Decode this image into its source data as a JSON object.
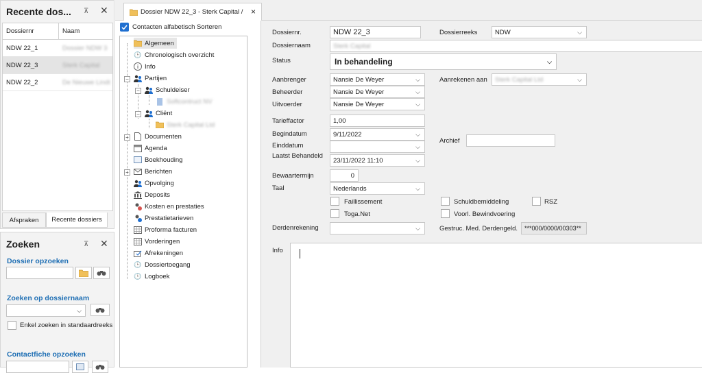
{
  "recent": {
    "title": "Recente dos...",
    "columns": [
      "Dossiernr",
      "Naam"
    ],
    "rows": [
      {
        "nr": "NDW 22_1",
        "naam": "Dossier NDW 3"
      },
      {
        "nr": "NDW 22_3",
        "naam": "Sterk Capital"
      },
      {
        "nr": "NDW 22_2",
        "naam": "De Nieuwe Lindt"
      }
    ],
    "bottom_tabs": [
      "Afspraken",
      "Recente dossiers"
    ]
  },
  "search": {
    "title": "Zoeken",
    "dossier_label": "Dossier opzoeken",
    "name_label": "Zoeken op dossiernaam",
    "checkbox_label": "Enkel zoeken in standaardreeks",
    "contact_label": "Contactfiche opzoeken"
  },
  "tab": {
    "label": "Dossier NDW 22_3 - Sterk Capital /",
    "close": "×"
  },
  "tree": {
    "sort_label": "Contacten alfabetisch Sorteren",
    "items": [
      {
        "label": "Algemeen",
        "icon": "folder-icon"
      },
      {
        "label": "Chronologisch overzicht",
        "icon": "clock-icon"
      },
      {
        "label": "Info",
        "icon": "info-icon"
      },
      {
        "label": "Partijen",
        "icon": "people-icon"
      },
      {
        "label": "Schuldeiser",
        "icon": "people-icon"
      },
      {
        "label": "Softcontruct NV",
        "icon": "contact-card-icon"
      },
      {
        "label": "Cliënt",
        "icon": "people-icon"
      },
      {
        "label": "Sterk Capital Ltd",
        "icon": "folder-icon"
      },
      {
        "label": "Documenten",
        "icon": "document-icon"
      },
      {
        "label": "Agenda",
        "icon": "calendar-icon"
      },
      {
        "label": "Boekhouding",
        "icon": "ledger-icon"
      },
      {
        "label": "Berichten",
        "icon": "envelope-icon"
      },
      {
        "label": "Opvolging",
        "icon": "people-icon"
      },
      {
        "label": "Deposits",
        "icon": "bank-icon"
      },
      {
        "label": "Kosten en prestaties",
        "icon": "cost-icon"
      },
      {
        "label": "Prestatietarieven",
        "icon": "rate-icon"
      },
      {
        "label": "Proforma facturen",
        "icon": "grid-icon"
      },
      {
        "label": "Vorderingen",
        "icon": "grid-icon"
      },
      {
        "label": "Afrekeningen",
        "icon": "settle-icon"
      },
      {
        "label": "Dossiertoegang",
        "icon": "clock-icon"
      },
      {
        "label": "Logboek",
        "icon": "clock-icon"
      }
    ]
  },
  "form": {
    "dossiernr_label": "Dossiernr.",
    "dossiernr_value": "NDW 22_3",
    "dossierreeks_label": "Dossierreeks",
    "dossierreeks_value": "NDW",
    "dossiernaam_label": "Dossiernaam",
    "dossiernaam_value": "Sterk Capital",
    "status_label": "Status",
    "status_value": "In behandeling",
    "aanbrenger_label": "Aanbrenger",
    "aanbrenger_value": "Nansie De Weyer",
    "aanrekenen_label": "Aanrekenen aan",
    "aanrekenen_value": "Sterk Capital Ltd",
    "beheerder_label": "Beheerder",
    "beheerder_value": "Nansie De Weyer",
    "uitvoerder_label": "Uitvoerder",
    "uitvoerder_value": "Nansie De Weyer",
    "tarieffactor_label": "Tarieffactor",
    "tarieffactor_value": "1,00",
    "begindatum_label": "Begindatum",
    "begindatum_value": "9/11/2022",
    "archief_label": "Archief",
    "einddatum_label": "Einddatum",
    "laatst_label": "Laatst Behandeld",
    "laatst_value": "23/11/2022 11:10",
    "bewaartermijn_label": "Bewaartermijn",
    "bewaartermijn_value": "0",
    "taal_label": "Taal",
    "taal_value": "Nederlands",
    "faillissement_label": "Faillissement",
    "schuldbemiddeling_label": "Schuldbemiddeling",
    "rsz_label": "RSZ",
    "toganet_label": "Toga.Net",
    "bewindvoering_label": "Voorl. Bewindvoering",
    "derdenrekening_label": "Derdenrekening",
    "gestruc_label": "Gestruc. Med. Derdengeld.",
    "gestruc_value": "***000/0000/00303**",
    "info_label": "Info"
  }
}
